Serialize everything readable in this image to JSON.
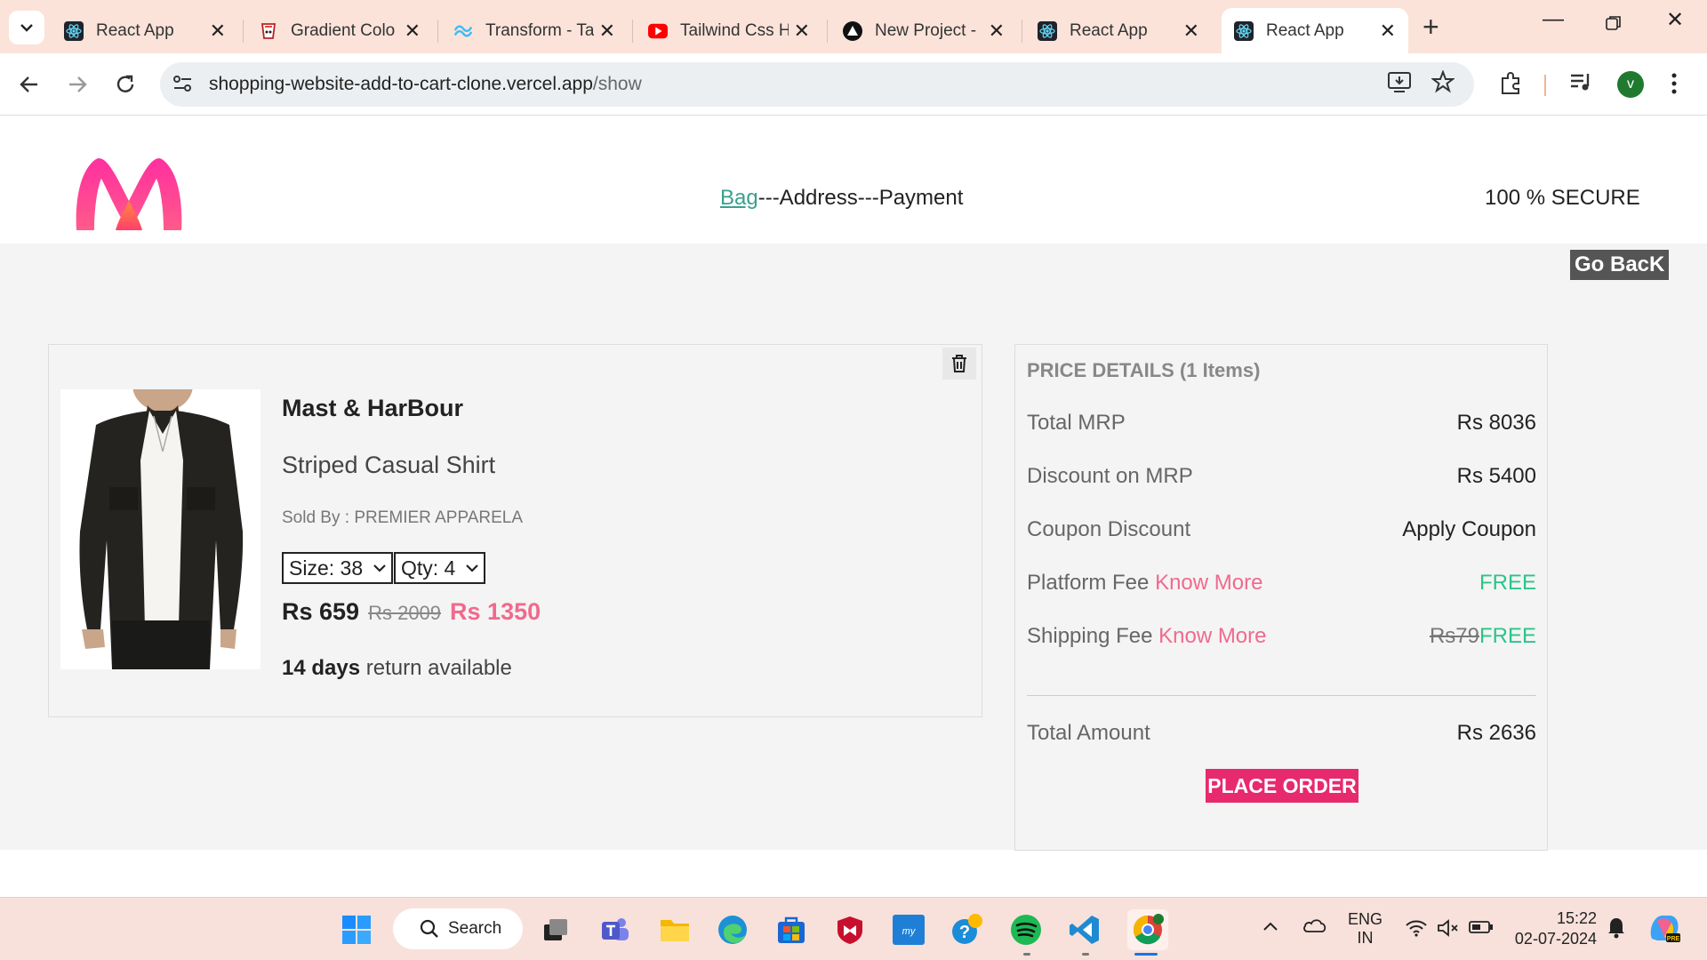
{
  "browser": {
    "tabs": [
      {
        "title": "React App",
        "icon": "react-icon",
        "active": false
      },
      {
        "title": "Gradient Colo",
        "icon": "gradient-icon",
        "active": false
      },
      {
        "title": "Transform - Ta",
        "icon": "tailwind-icon",
        "active": false
      },
      {
        "title": "Tailwind Css H",
        "icon": "youtube-icon",
        "active": false
      },
      {
        "title": "New Project -",
        "icon": "vercel-icon",
        "active": false
      },
      {
        "title": "React App",
        "icon": "react-icon",
        "active": false
      },
      {
        "title": "React App",
        "icon": "react-icon",
        "active": true
      }
    ],
    "url_host": "shopping-website-add-to-cart-clone.vercel.app",
    "url_path": "/show",
    "profile_initial": "v"
  },
  "header": {
    "step_bag": "Bag",
    "step_rest": "---Address---Payment",
    "secure_label": "100 % SECURE"
  },
  "go_back_label": "Go BacK",
  "cart_item": {
    "brand": "Mast & HarBour",
    "name": "Striped Casual Shirt",
    "sold_by": "Sold By : PREMIER APPARELA",
    "size_label": "Size: 38",
    "qty_label": "Qty: 4",
    "price": "Rs 659",
    "mrp": "Rs 2009",
    "discount": "Rs 1350",
    "return_days": "14 days",
    "return_text": " return available"
  },
  "price_details": {
    "heading": "PRICE DETAILS (1 Items)",
    "total_mrp_label": "Total MRP",
    "total_mrp_value": "Rs 8036",
    "discount_label": "Discount on MRP",
    "discount_value": "Rs 5400",
    "coupon_label": "Coupon Discount",
    "coupon_value": "Apply Coupon",
    "platform_label": "Platform Fee",
    "platform_link": "Know More",
    "platform_value": "FREE",
    "shipping_label": "Shipping Fee",
    "shipping_link": "Know More",
    "shipping_old": "Rs79",
    "shipping_value": "FREE",
    "total_label": "Total Amount",
    "total_value": "Rs 2636",
    "place_order_label": "PLACE ORDER"
  },
  "taskbar": {
    "search_label": "Search",
    "lang_top": "ENG",
    "lang_bottom": "IN",
    "time": "15:22",
    "date": "02-07-2024"
  },
  "colors": {
    "accent_pink": "#f06a8d",
    "place_order": "#e72a6d",
    "free_green": "#2bc48a",
    "bag_link": "#3aa08d"
  }
}
